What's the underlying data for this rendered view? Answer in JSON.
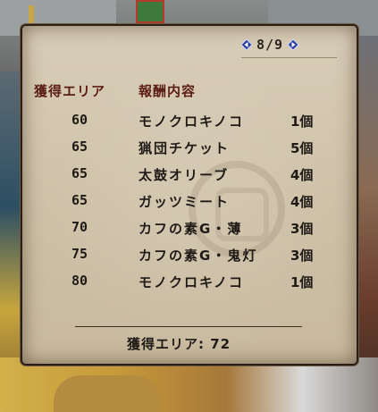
{
  "pager": {
    "text": "8/9"
  },
  "header": {
    "area_label": "獲得エリア",
    "reward_label": "報酬内容"
  },
  "rewards": [
    {
      "area": "60",
      "item": "モノクロキノコ",
      "qty": "1個"
    },
    {
      "area": "65",
      "item": "猟団チケット",
      "qty": "5個"
    },
    {
      "area": "65",
      "item": "太鼓オリーブ",
      "qty": "4個"
    },
    {
      "area": "65",
      "item": "ガッツミート",
      "qty": "4個"
    },
    {
      "area": "70",
      "item": "カフの素G・薄",
      "qty": "3個"
    },
    {
      "area": "75",
      "item": "カフの素G・鬼灯",
      "qty": "3個"
    },
    {
      "area": "80",
      "item": "モノクロキノコ",
      "qty": "1個"
    }
  ],
  "footer": {
    "total": "獲得エリア: 72"
  },
  "colors": {
    "header_text": "#5b1d14",
    "body_text": "#1f1a16",
    "parchment": "#cfc2a9",
    "arrow": "#3d5bd6"
  }
}
